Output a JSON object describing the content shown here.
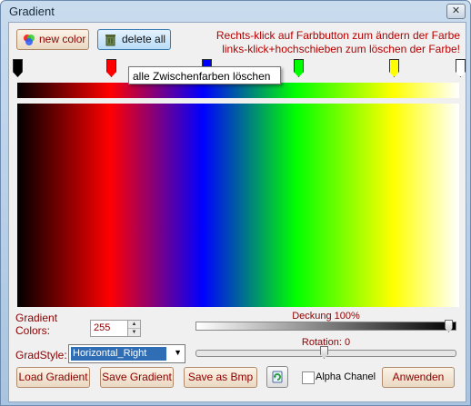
{
  "window": {
    "title": "Gradient",
    "close_glyph": "✕"
  },
  "toolbar": {
    "new_color_label": "new color",
    "new_color_icon": "color-wheel-icon",
    "delete_all_label": "delete all",
    "delete_all_icon": "trash-icon"
  },
  "hint": {
    "line1": "Rechts-klick auf Farbbutton zum ändern der Farbe",
    "line2": "links-klick+hochschieben zum löschen der Farbe!"
  },
  "tooltip": "alle Zwischenfarben löschen",
  "markers": [
    {
      "color": "#000000"
    },
    {
      "color": "#ff0000"
    },
    {
      "color": "#0000ff"
    },
    {
      "color": "#00ff00"
    },
    {
      "color": "#ffff00"
    },
    {
      "color": "#ffffff"
    }
  ],
  "gradient_colors": {
    "label_line1": "Gradient",
    "label_line2": "Colors:",
    "value": "255"
  },
  "deckung": {
    "label": "Deckung 100%",
    "value_percent": 100
  },
  "rotation": {
    "label": "Rotation: 0",
    "value": 0
  },
  "grad_style": {
    "label": "GradStyle:",
    "selected": "Horizontal_Right"
  },
  "buttons": {
    "load": "Load Gradient",
    "save": "Save Gradient",
    "save_bmp": "Save as Bmp",
    "apply": "Anwenden"
  },
  "alpha": {
    "label": "Alpha Chanel",
    "checked": false
  },
  "colors": {
    "label_red": "#8b0000",
    "hint_red": "#b50000"
  }
}
